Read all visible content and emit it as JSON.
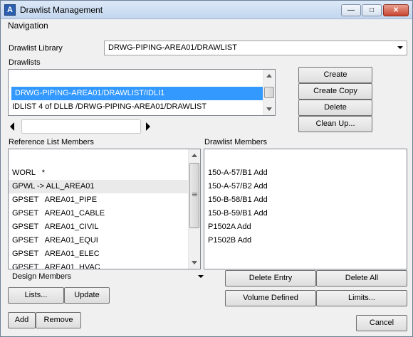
{
  "window": {
    "title": "Drawlist Management",
    "icon": "app-logo-icon",
    "min": "—",
    "max": "□",
    "close": "✕"
  },
  "menu": {
    "navigation": "Navigation"
  },
  "library": {
    "label": "Drawlist Library",
    "value": "DRWG-PIPING-AREA01/DRAWLIST"
  },
  "drawlists": {
    "label": "Drawlists",
    "items": [
      "DRWG-PIPING-AREA01/DRAWLIST/IDLI1",
      "IDLIST 4 of DLLB /DRWG-PIPING-AREA01/DRAWLIST"
    ],
    "selected": 0
  },
  "buttons": {
    "create": "Create",
    "create_copy": "Create Copy",
    "delete": "Delete",
    "clean_up": "Clean Up...",
    "delete_entry": "Delete Entry",
    "delete_all": "Delete All",
    "volume_defined": "Volume Defined",
    "limits": "Limits...",
    "lists": "Lists...",
    "update": "Update",
    "add": "Add",
    "remove": "Remove",
    "cancel": "Cancel"
  },
  "reference": {
    "label": "Reference List Members",
    "items": [
      {
        "type": "WORL",
        "name": "*"
      },
      {
        "type": "GPWL ->",
        "name": "ALL_AREA01"
      },
      {
        "type": "GPSET",
        "name": "AREA01_PIPE"
      },
      {
        "type": "GPSET",
        "name": "AREA01_CABLE"
      },
      {
        "type": "GPSET",
        "name": "AREA01_CIVIL"
      },
      {
        "type": "GPSET",
        "name": "AREA01_EQUI"
      },
      {
        "type": "GPSET",
        "name": "AREA01_ELEC"
      },
      {
        "type": "GPSET",
        "name": "AREA01_HVAC"
      }
    ]
  },
  "drawlist_members": {
    "label": "Drawlist Members",
    "items": [
      "150-A-57/B1 Add",
      "150-A-57/B2 Add",
      "150-B-58/B1 Add",
      "150-B-59/B1 Add",
      "P1502A Add",
      "P1502B Add"
    ]
  },
  "members_filter": {
    "value": "Design Members"
  }
}
